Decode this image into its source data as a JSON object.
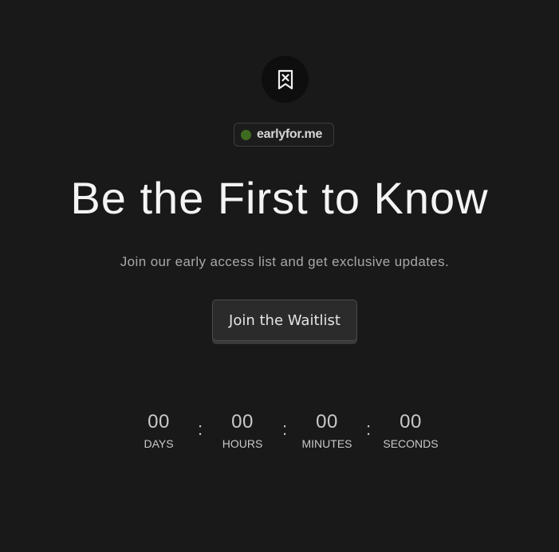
{
  "logo": {
    "icon": "bookmark-x-icon"
  },
  "badge": {
    "dot_color": "#3f6b21",
    "label": "earlyfor.me"
  },
  "hero": {
    "headline": "Be the First to Know",
    "subtitle": "Join our early access list and get exclusive updates."
  },
  "cta": {
    "label": "Join the Waitlist"
  },
  "countdown": {
    "days": {
      "value": "00",
      "label": "DAYS"
    },
    "hours": {
      "value": "00",
      "label": "HOURS"
    },
    "minutes": {
      "value": "00",
      "label": "MINUTES"
    },
    "seconds": {
      "value": "00",
      "label": "SECONDS"
    },
    "separator": ":"
  },
  "colors": {
    "background": "#191919",
    "text": "#f4f4f4",
    "muted": "#a8a8a8"
  }
}
